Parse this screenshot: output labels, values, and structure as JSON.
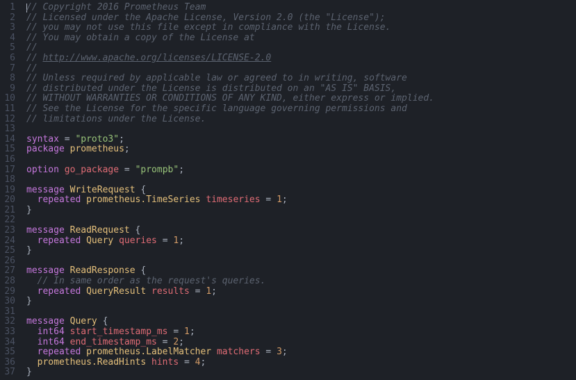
{
  "editor": {
    "language": "proto3",
    "lines": [
      {
        "n": 1,
        "tokens": [
          {
            "t": "cursor"
          },
          {
            "t": "comment",
            "v": "// Copyright 2016 Prometheus Team"
          }
        ]
      },
      {
        "n": 2,
        "tokens": [
          {
            "t": "comment",
            "v": "// Licensed under the Apache License, Version 2.0 (the \"License\");"
          }
        ]
      },
      {
        "n": 3,
        "tokens": [
          {
            "t": "comment",
            "v": "// you may not use this file except in compliance with the License."
          }
        ]
      },
      {
        "n": 4,
        "tokens": [
          {
            "t": "comment",
            "v": "// You may obtain a copy of the License at"
          }
        ]
      },
      {
        "n": 5,
        "tokens": [
          {
            "t": "comment",
            "v": "//"
          }
        ]
      },
      {
        "n": 6,
        "tokens": [
          {
            "t": "comment",
            "v": "// "
          },
          {
            "t": "link",
            "v": "http://www.apache.org/licenses/LICENSE-2.0"
          }
        ]
      },
      {
        "n": 7,
        "tokens": [
          {
            "t": "comment",
            "v": "//"
          }
        ]
      },
      {
        "n": 8,
        "tokens": [
          {
            "t": "comment",
            "v": "// Unless required by applicable law or agreed to in writing, software"
          }
        ]
      },
      {
        "n": 9,
        "tokens": [
          {
            "t": "comment",
            "v": "// distributed under the License is distributed on an \"AS IS\" BASIS,"
          }
        ]
      },
      {
        "n": 10,
        "tokens": [
          {
            "t": "comment",
            "v": "// WITHOUT WARRANTIES OR CONDITIONS OF ANY KIND, either express or implied."
          }
        ]
      },
      {
        "n": 11,
        "tokens": [
          {
            "t": "comment",
            "v": "// See the License for the specific language governing permissions and"
          }
        ]
      },
      {
        "n": 12,
        "tokens": [
          {
            "t": "comment",
            "v": "// limitations under the License."
          }
        ]
      },
      {
        "n": 13,
        "tokens": []
      },
      {
        "n": 14,
        "tokens": [
          {
            "t": "keyword",
            "v": "syntax"
          },
          {
            "t": "punct",
            "v": " = "
          },
          {
            "t": "string",
            "v": "\"proto3\""
          },
          {
            "t": "punct",
            "v": ";"
          }
        ]
      },
      {
        "n": 15,
        "tokens": [
          {
            "t": "keyword",
            "v": "package"
          },
          {
            "t": "punct",
            "v": " "
          },
          {
            "t": "type",
            "v": "prometheus"
          },
          {
            "t": "punct",
            "v": ";"
          }
        ]
      },
      {
        "n": 16,
        "tokens": []
      },
      {
        "n": 17,
        "tokens": [
          {
            "t": "keyword",
            "v": "option"
          },
          {
            "t": "punct",
            "v": " "
          },
          {
            "t": "ident",
            "v": "go_package"
          },
          {
            "t": "punct",
            "v": " = "
          },
          {
            "t": "string",
            "v": "\"prompb\""
          },
          {
            "t": "punct",
            "v": ";"
          }
        ]
      },
      {
        "n": 18,
        "tokens": []
      },
      {
        "n": 19,
        "tokens": [
          {
            "t": "keyword",
            "v": "message"
          },
          {
            "t": "punct",
            "v": " "
          },
          {
            "t": "type",
            "v": "WriteRequest"
          },
          {
            "t": "punct",
            "v": " {"
          }
        ]
      },
      {
        "n": 20,
        "tokens": [
          {
            "t": "punct",
            "v": "  "
          },
          {
            "t": "keyword",
            "v": "repeated"
          },
          {
            "t": "punct",
            "v": " "
          },
          {
            "t": "type",
            "v": "prometheus.TimeSeries"
          },
          {
            "t": "punct",
            "v": " "
          },
          {
            "t": "ident",
            "v": "timeseries"
          },
          {
            "t": "punct",
            "v": " = "
          },
          {
            "t": "number",
            "v": "1"
          },
          {
            "t": "punct",
            "v": ";"
          }
        ]
      },
      {
        "n": 21,
        "tokens": [
          {
            "t": "punct",
            "v": "}"
          }
        ]
      },
      {
        "n": 22,
        "tokens": []
      },
      {
        "n": 23,
        "tokens": [
          {
            "t": "keyword",
            "v": "message"
          },
          {
            "t": "punct",
            "v": " "
          },
          {
            "t": "type",
            "v": "ReadRequest"
          },
          {
            "t": "punct",
            "v": " {"
          }
        ]
      },
      {
        "n": 24,
        "tokens": [
          {
            "t": "punct",
            "v": "  "
          },
          {
            "t": "keyword",
            "v": "repeated"
          },
          {
            "t": "punct",
            "v": " "
          },
          {
            "t": "type",
            "v": "Query"
          },
          {
            "t": "punct",
            "v": " "
          },
          {
            "t": "ident",
            "v": "queries"
          },
          {
            "t": "punct",
            "v": " = "
          },
          {
            "t": "number",
            "v": "1"
          },
          {
            "t": "punct",
            "v": ";"
          }
        ]
      },
      {
        "n": 25,
        "tokens": [
          {
            "t": "punct",
            "v": "}"
          }
        ]
      },
      {
        "n": 26,
        "tokens": []
      },
      {
        "n": 27,
        "tokens": [
          {
            "t": "keyword",
            "v": "message"
          },
          {
            "t": "punct",
            "v": " "
          },
          {
            "t": "type",
            "v": "ReadResponse"
          },
          {
            "t": "punct",
            "v": " {"
          }
        ]
      },
      {
        "n": 28,
        "tokens": [
          {
            "t": "punct",
            "v": "  "
          },
          {
            "t": "comment",
            "v": "// In same order as the request's queries."
          }
        ]
      },
      {
        "n": 29,
        "tokens": [
          {
            "t": "punct",
            "v": "  "
          },
          {
            "t": "keyword",
            "v": "repeated"
          },
          {
            "t": "punct",
            "v": " "
          },
          {
            "t": "type",
            "v": "QueryResult"
          },
          {
            "t": "punct",
            "v": " "
          },
          {
            "t": "ident",
            "v": "results"
          },
          {
            "t": "punct",
            "v": " = "
          },
          {
            "t": "number",
            "v": "1"
          },
          {
            "t": "punct",
            "v": ";"
          }
        ]
      },
      {
        "n": 30,
        "tokens": [
          {
            "t": "punct",
            "v": "}"
          }
        ]
      },
      {
        "n": 31,
        "tokens": []
      },
      {
        "n": 32,
        "tokens": [
          {
            "t": "keyword",
            "v": "message"
          },
          {
            "t": "punct",
            "v": " "
          },
          {
            "t": "type",
            "v": "Query"
          },
          {
            "t": "punct",
            "v": " {"
          }
        ]
      },
      {
        "n": 33,
        "tokens": [
          {
            "t": "punct",
            "v": "  "
          },
          {
            "t": "keyword",
            "v": "int64"
          },
          {
            "t": "punct",
            "v": " "
          },
          {
            "t": "ident",
            "v": "start_timestamp_ms"
          },
          {
            "t": "punct",
            "v": " = "
          },
          {
            "t": "number",
            "v": "1"
          },
          {
            "t": "punct",
            "v": ";"
          }
        ]
      },
      {
        "n": 34,
        "tokens": [
          {
            "t": "punct",
            "v": "  "
          },
          {
            "t": "keyword",
            "v": "int64"
          },
          {
            "t": "punct",
            "v": " "
          },
          {
            "t": "ident",
            "v": "end_timestamp_ms"
          },
          {
            "t": "punct",
            "v": " = "
          },
          {
            "t": "number",
            "v": "2"
          },
          {
            "t": "punct",
            "v": ";"
          }
        ]
      },
      {
        "n": 35,
        "tokens": [
          {
            "t": "punct",
            "v": "  "
          },
          {
            "t": "keyword",
            "v": "repeated"
          },
          {
            "t": "punct",
            "v": " "
          },
          {
            "t": "type",
            "v": "prometheus.LabelMatcher"
          },
          {
            "t": "punct",
            "v": " "
          },
          {
            "t": "ident",
            "v": "matchers"
          },
          {
            "t": "punct",
            "v": " = "
          },
          {
            "t": "number",
            "v": "3"
          },
          {
            "t": "punct",
            "v": ";"
          }
        ]
      },
      {
        "n": 36,
        "tokens": [
          {
            "t": "punct",
            "v": "  "
          },
          {
            "t": "type",
            "v": "prometheus.ReadHints"
          },
          {
            "t": "punct",
            "v": " "
          },
          {
            "t": "ident",
            "v": "hints"
          },
          {
            "t": "punct",
            "v": " = "
          },
          {
            "t": "number",
            "v": "4"
          },
          {
            "t": "punct",
            "v": ";"
          }
        ]
      },
      {
        "n": 37,
        "tokens": [
          {
            "t": "punct",
            "v": "}"
          }
        ]
      }
    ]
  }
}
